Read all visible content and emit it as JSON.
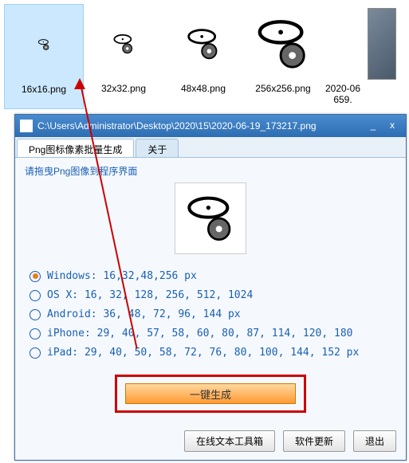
{
  "explorer": {
    "files": [
      {
        "name": "16x16.png",
        "selected": true
      },
      {
        "name": "32x32.png",
        "selected": false
      },
      {
        "name": "48x48.png",
        "selected": false
      },
      {
        "name": "256x256.png",
        "selected": false
      },
      {
        "name": "2020-06\n659."
      }
    ]
  },
  "window": {
    "title": "C:\\Users\\Administrator\\Desktop\\2020\\15\\2020-06-19_173217.png",
    "min": "_",
    "close": "x"
  },
  "tabs": {
    "t1": "Png图标像素批量生成",
    "t2": "关于"
  },
  "hint": "请拖曳Png图像到程序界面",
  "options": {
    "windows": "Windows: 16,32,48,256 px",
    "osx": "OS X: 16, 32, 128, 256, 512, 1024",
    "android": "Android: 36, 48, 72, 96, 144 px",
    "iphone": "iPhone: 29, 40, 57, 58, 60, 80, 87, 114, 120, 180",
    "ipad": "iPad: 29, 40, 50, 58, 72, 76, 80, 100, 144, 152 px"
  },
  "buttons": {
    "generate": "一键生成",
    "toolbox": "在线文本工具箱",
    "update": "软件更新",
    "exit": "退出"
  }
}
